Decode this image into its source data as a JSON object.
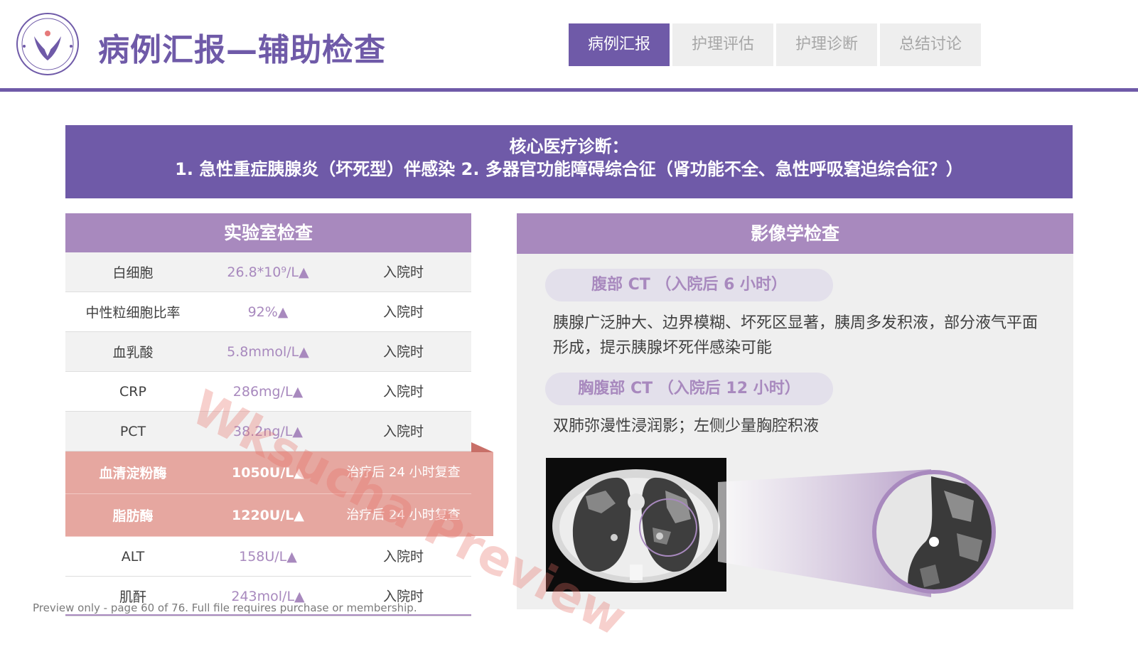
{
  "header": {
    "title": "病例汇报—辅助检查",
    "nav_tabs": [
      {
        "label": "病例汇报",
        "active": true
      },
      {
        "label": "护理评估",
        "active": false
      },
      {
        "label": "护理诊断",
        "active": false
      },
      {
        "label": "总结讨论",
        "active": false
      }
    ]
  },
  "diagnosis": {
    "title": "核心医疗诊断：",
    "text": "1. 急性重症胰腺炎（坏死型）伴感染 2. 多器官功能障碍综合征（肾功能不全、急性呼吸窘迫综合征？）"
  },
  "lab": {
    "title": "实验室检查",
    "rows": [
      {
        "item": "白细胞",
        "value": "26.8*10⁹/L▲",
        "time": "入院时"
      },
      {
        "item": "中性粒细胞比率",
        "value": "92%▲",
        "time": "入院时"
      },
      {
        "item": "血乳酸",
        "value": "5.8mmol/L▲",
        "time": "入院时"
      },
      {
        "item": "CRP",
        "value": "286mg/L▲",
        "time": "入院时"
      },
      {
        "item": "PCT",
        "value": "38.2ng/L▲",
        "time": "入院时"
      },
      {
        "item": "血清淀粉酶",
        "value": "1050U/L▲",
        "time": "治疗后 24 小时复查"
      },
      {
        "item": "脂肪酶",
        "value": "1220U/L▲",
        "time": "治疗后 24 小时复查"
      },
      {
        "item": "ALT",
        "value": "158U/L▲",
        "time": "入院时"
      },
      {
        "item": "肌酐",
        "value": "243mol/L▲",
        "time": "入院时"
      }
    ]
  },
  "imaging": {
    "title": "影像学检查",
    "exams": [
      {
        "label": "腹部 CT （入院后 6 小时）",
        "finding": "胰腺广泛肿大、边界模糊、坏死区显著，胰周多发积液，部分液气平面形成，提示胰腺坏死伴感染可能"
      },
      {
        "label": "胸腹部 CT （入院后 12 小时）",
        "finding": "双肺弥漫性浸润影；左侧少量胸腔积液"
      }
    ]
  },
  "watermark": "Wksucha Preview",
  "footer": "Preview only - page 60 of 76. Full file requires purchase or membership.",
  "colors": {
    "primary": "#6f5aa8",
    "secondary": "#a889be",
    "highlight": "#e6a7a0"
  }
}
